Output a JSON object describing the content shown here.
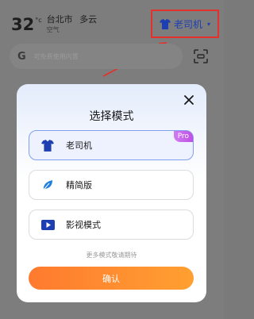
{
  "weather": {
    "temperature": "32",
    "unit": "°c",
    "city": "台北市",
    "condition": "多云",
    "air_label": "空气"
  },
  "mode_switch": {
    "label": "老司机",
    "caret": "▾"
  },
  "search": {
    "logo": "G",
    "placeholder": "可免费使用内置"
  },
  "modal": {
    "title": "选择模式",
    "options": [
      {
        "label": "老司机",
        "badge": "Pro",
        "icon": "cape-shirt-icon",
        "selected": true
      },
      {
        "label": "精简版",
        "icon": "leaf-icon",
        "selected": false
      },
      {
        "label": "影视模式",
        "icon": "play-icon",
        "selected": false
      }
    ],
    "more_text": "更多模式敬请期待",
    "confirm_label": "确认"
  },
  "colors": {
    "accent_blue": "#1d3fb0",
    "highlight_red": "#e5302c",
    "confirm_orange_start": "#ff7a2f",
    "confirm_orange_end": "#ffa030",
    "pro_purple": "#c04fe6",
    "leaf_blue": "#1f7fe0"
  }
}
